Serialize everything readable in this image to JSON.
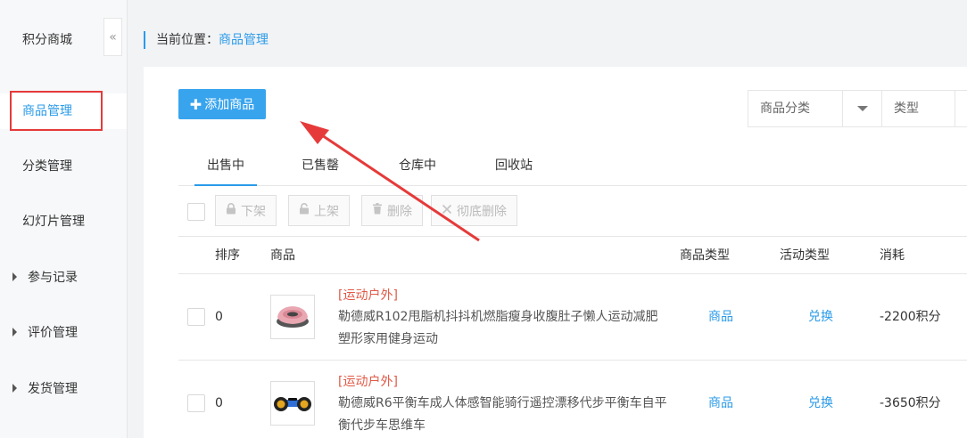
{
  "sidebar": {
    "title": "积分商城",
    "collapse_icon": "«",
    "items": [
      {
        "label": "商品管理"
      },
      {
        "label": "分类管理"
      },
      {
        "label": "幻灯片管理"
      }
    ],
    "groups": [
      {
        "label": "参与记录"
      },
      {
        "label": "评价管理"
      },
      {
        "label": "发货管理"
      }
    ]
  },
  "breadcrumb": {
    "prefix": "当前位置：",
    "current": "商品管理"
  },
  "toolbar": {
    "add_label": "添加商品",
    "add_icon": "✚",
    "category_placeholder": "商品分类",
    "type_placeholder": "类型"
  },
  "tabs": [
    {
      "label": "出售中"
    },
    {
      "label": "已售罄"
    },
    {
      "label": "仓库中"
    },
    {
      "label": "回收站"
    }
  ],
  "bulk_actions": [
    {
      "label": "下架",
      "icon": "lock-icon"
    },
    {
      "label": "上架",
      "icon": "unlock-icon"
    },
    {
      "label": "删除",
      "icon": "trash-icon"
    },
    {
      "label": "彻底删除",
      "icon": "close-icon"
    }
  ],
  "table": {
    "headers": {
      "order": "排序",
      "product": "商品",
      "product_type": "商品类型",
      "activity_type": "活动类型",
      "cost": "消耗"
    },
    "rows": [
      {
        "order": "0",
        "tag": "[运动户外]",
        "name": "勒德威R102甩脂机抖抖机燃脂瘦身收腹肚子懒人运动减肥塑形家用健身运动",
        "product_type": "商品",
        "activity_type": "兑换",
        "cost": "-2200积分"
      },
      {
        "order": "0",
        "tag": "[运动户外]",
        "name": "勒德威R6平衡车成人体感智能骑行遥控漂移代步平衡车自平衡代步车思维车",
        "product_type": "商品",
        "activity_type": "兑换",
        "cost": "-3650积分"
      }
    ]
  },
  "colors": {
    "accent": "#2a9be9",
    "primary_button": "#38a4ee",
    "tag_red": "#e05a47",
    "annotation_red": "#e63a3a"
  }
}
